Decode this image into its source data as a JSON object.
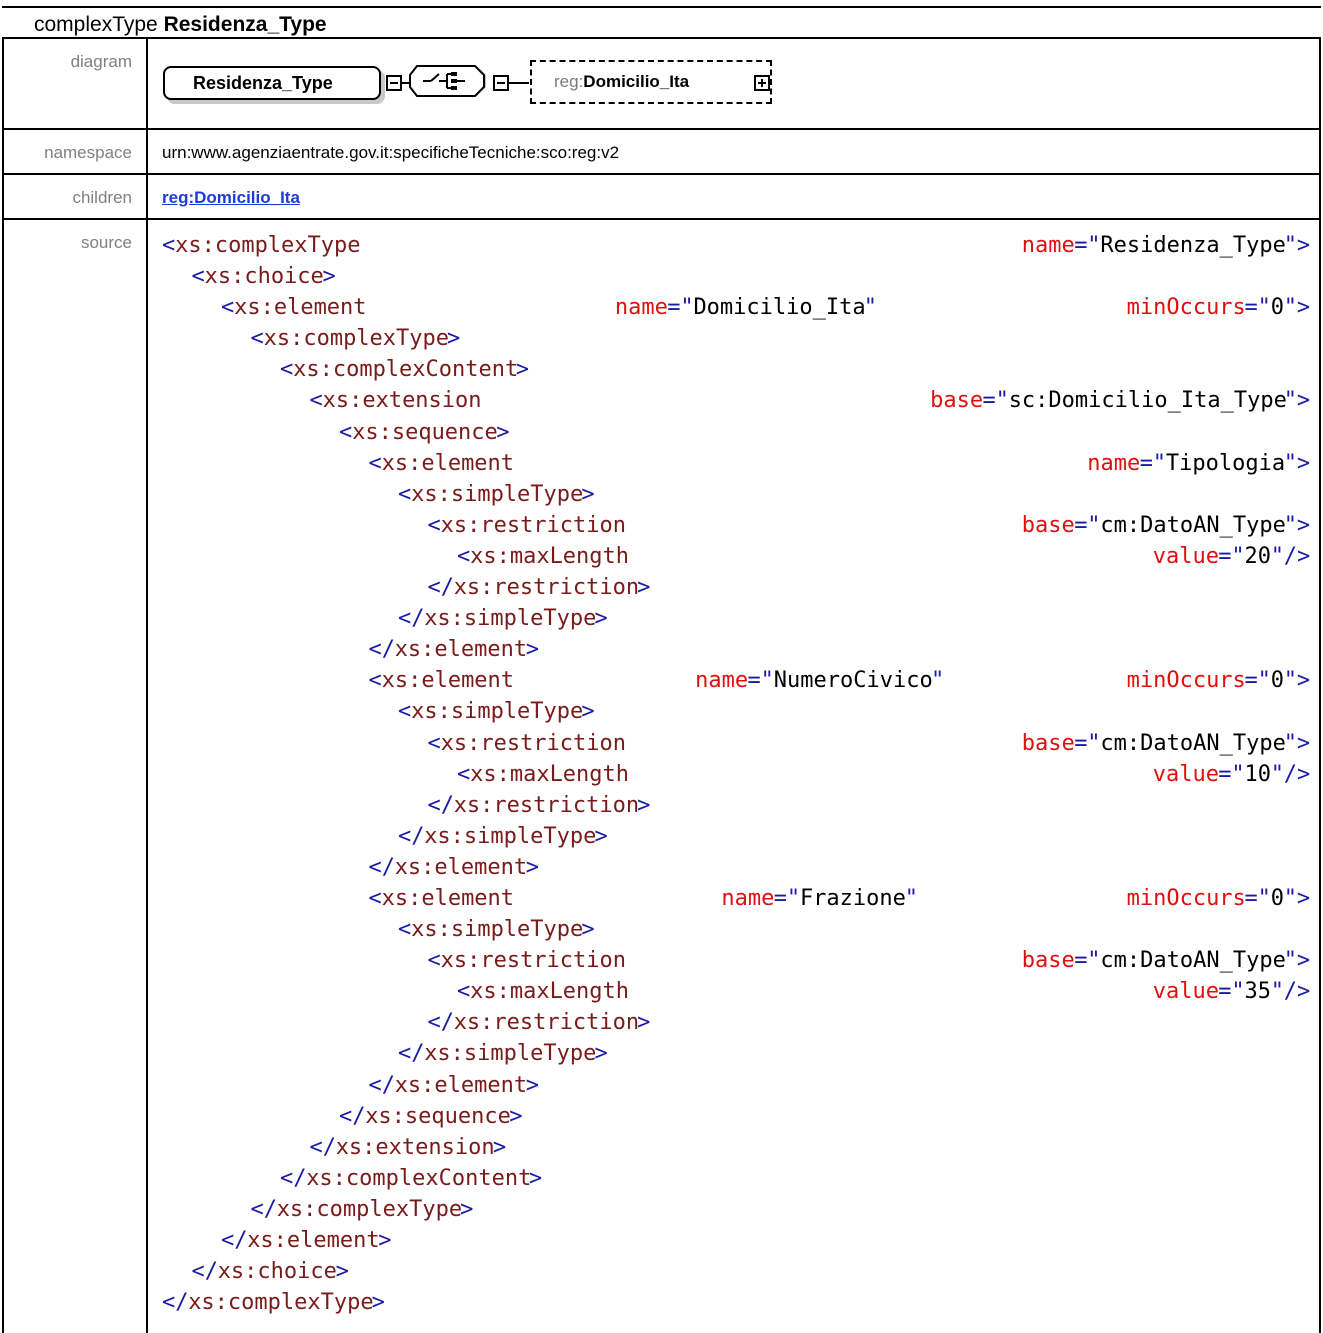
{
  "header": {
    "kind": "complexType",
    "name": "Residenza_Type"
  },
  "rows": {
    "diagram_label": "diagram",
    "namespace_label": "namespace",
    "namespace_value": "urn:www.agenziaentrate.gov.it:specificheTecniche:sco:reg:v2",
    "children_label": "children",
    "children_value": "reg:Domicilio_Ita",
    "source_label": "source"
  },
  "diagram": {
    "main_element": "Residenza_Type",
    "ref_prefix": "reg:",
    "ref_name": "Domicilio_Ita"
  },
  "source_lines": [
    {
      "indent": 0,
      "tag": "xs:complexType",
      "attrs": [
        {
          "n": "name",
          "v": "Residenza_Type"
        }
      ],
      "close": ">"
    },
    {
      "indent": 1,
      "tag": "xs:choice",
      "attrs": [],
      "close": ">"
    },
    {
      "indent": 2,
      "tag": "xs:element",
      "attrs": [
        {
          "n": "name",
          "v": "Domicilio_Ita"
        },
        {
          "n": "minOccurs",
          "v": "0"
        }
      ],
      "close": ">"
    },
    {
      "indent": 3,
      "tag": "xs:complexType",
      "attrs": [],
      "close": ">"
    },
    {
      "indent": 4,
      "tag": "xs:complexContent",
      "attrs": [],
      "close": ">"
    },
    {
      "indent": 5,
      "tag": "xs:extension",
      "attrs": [
        {
          "n": "base",
          "v": "sc:Domicilio_Ita_Type"
        }
      ],
      "close": ">"
    },
    {
      "indent": 6,
      "tag": "xs:sequence",
      "attrs": [],
      "close": ">"
    },
    {
      "indent": 7,
      "tag": "xs:element",
      "attrs": [
        {
          "n": "name",
          "v": "Tipologia"
        }
      ],
      "close": ">"
    },
    {
      "indent": 8,
      "tag": "xs:simpleType",
      "attrs": [],
      "close": ">"
    },
    {
      "indent": 9,
      "tag": "xs:restriction",
      "attrs": [
        {
          "n": "base",
          "v": "cm:DatoAN_Type"
        }
      ],
      "close": ">"
    },
    {
      "indent": 10,
      "tag": "xs:maxLength",
      "attrs": [
        {
          "n": "value",
          "v": "20"
        }
      ],
      "close": "/>"
    },
    {
      "indent": 9,
      "tag": "/xs:restriction",
      "attrs": [],
      "close": ">"
    },
    {
      "indent": 8,
      "tag": "/xs:simpleType",
      "attrs": [],
      "close": ">"
    },
    {
      "indent": 7,
      "tag": "/xs:element",
      "attrs": [],
      "close": ">"
    },
    {
      "indent": 7,
      "tag": "xs:element",
      "attrs": [
        {
          "n": "name",
          "v": "NumeroCivico"
        },
        {
          "n": "minOccurs",
          "v": "0"
        }
      ],
      "close": ">"
    },
    {
      "indent": 8,
      "tag": "xs:simpleType",
      "attrs": [],
      "close": ">"
    },
    {
      "indent": 9,
      "tag": "xs:restriction",
      "attrs": [
        {
          "n": "base",
          "v": "cm:DatoAN_Type"
        }
      ],
      "close": ">"
    },
    {
      "indent": 10,
      "tag": "xs:maxLength",
      "attrs": [
        {
          "n": "value",
          "v": "10"
        }
      ],
      "close": "/>"
    },
    {
      "indent": 9,
      "tag": "/xs:restriction",
      "attrs": [],
      "close": ">"
    },
    {
      "indent": 8,
      "tag": "/xs:simpleType",
      "attrs": [],
      "close": ">"
    },
    {
      "indent": 7,
      "tag": "/xs:element",
      "attrs": [],
      "close": ">"
    },
    {
      "indent": 7,
      "tag": "xs:element",
      "attrs": [
        {
          "n": "name",
          "v": "Frazione"
        },
        {
          "n": "minOccurs",
          "v": "0"
        }
      ],
      "close": ">"
    },
    {
      "indent": 8,
      "tag": "xs:simpleType",
      "attrs": [],
      "close": ">"
    },
    {
      "indent": 9,
      "tag": "xs:restriction",
      "attrs": [
        {
          "n": "base",
          "v": "cm:DatoAN_Type"
        }
      ],
      "close": ">"
    },
    {
      "indent": 10,
      "tag": "xs:maxLength",
      "attrs": [
        {
          "n": "value",
          "v": "35"
        }
      ],
      "close": "/>"
    },
    {
      "indent": 9,
      "tag": "/xs:restriction",
      "attrs": [],
      "close": ">"
    },
    {
      "indent": 8,
      "tag": "/xs:simpleType",
      "attrs": [],
      "close": ">"
    },
    {
      "indent": 7,
      "tag": "/xs:element",
      "attrs": [],
      "close": ">"
    },
    {
      "indent": 6,
      "tag": "/xs:sequence",
      "attrs": [],
      "close": ">"
    },
    {
      "indent": 5,
      "tag": "/xs:extension",
      "attrs": [],
      "close": ">"
    },
    {
      "indent": 4,
      "tag": "/xs:complexContent",
      "attrs": [],
      "close": ">"
    },
    {
      "indent": 3,
      "tag": "/xs:complexType",
      "attrs": [],
      "close": ">"
    },
    {
      "indent": 2,
      "tag": "/xs:element",
      "attrs": [],
      "close": ">"
    },
    {
      "indent": 1,
      "tag": "/xs:choice",
      "attrs": [],
      "close": ">"
    },
    {
      "indent": 0,
      "tag": "/xs:complexType",
      "attrs": [],
      "close": ">"
    }
  ]
}
